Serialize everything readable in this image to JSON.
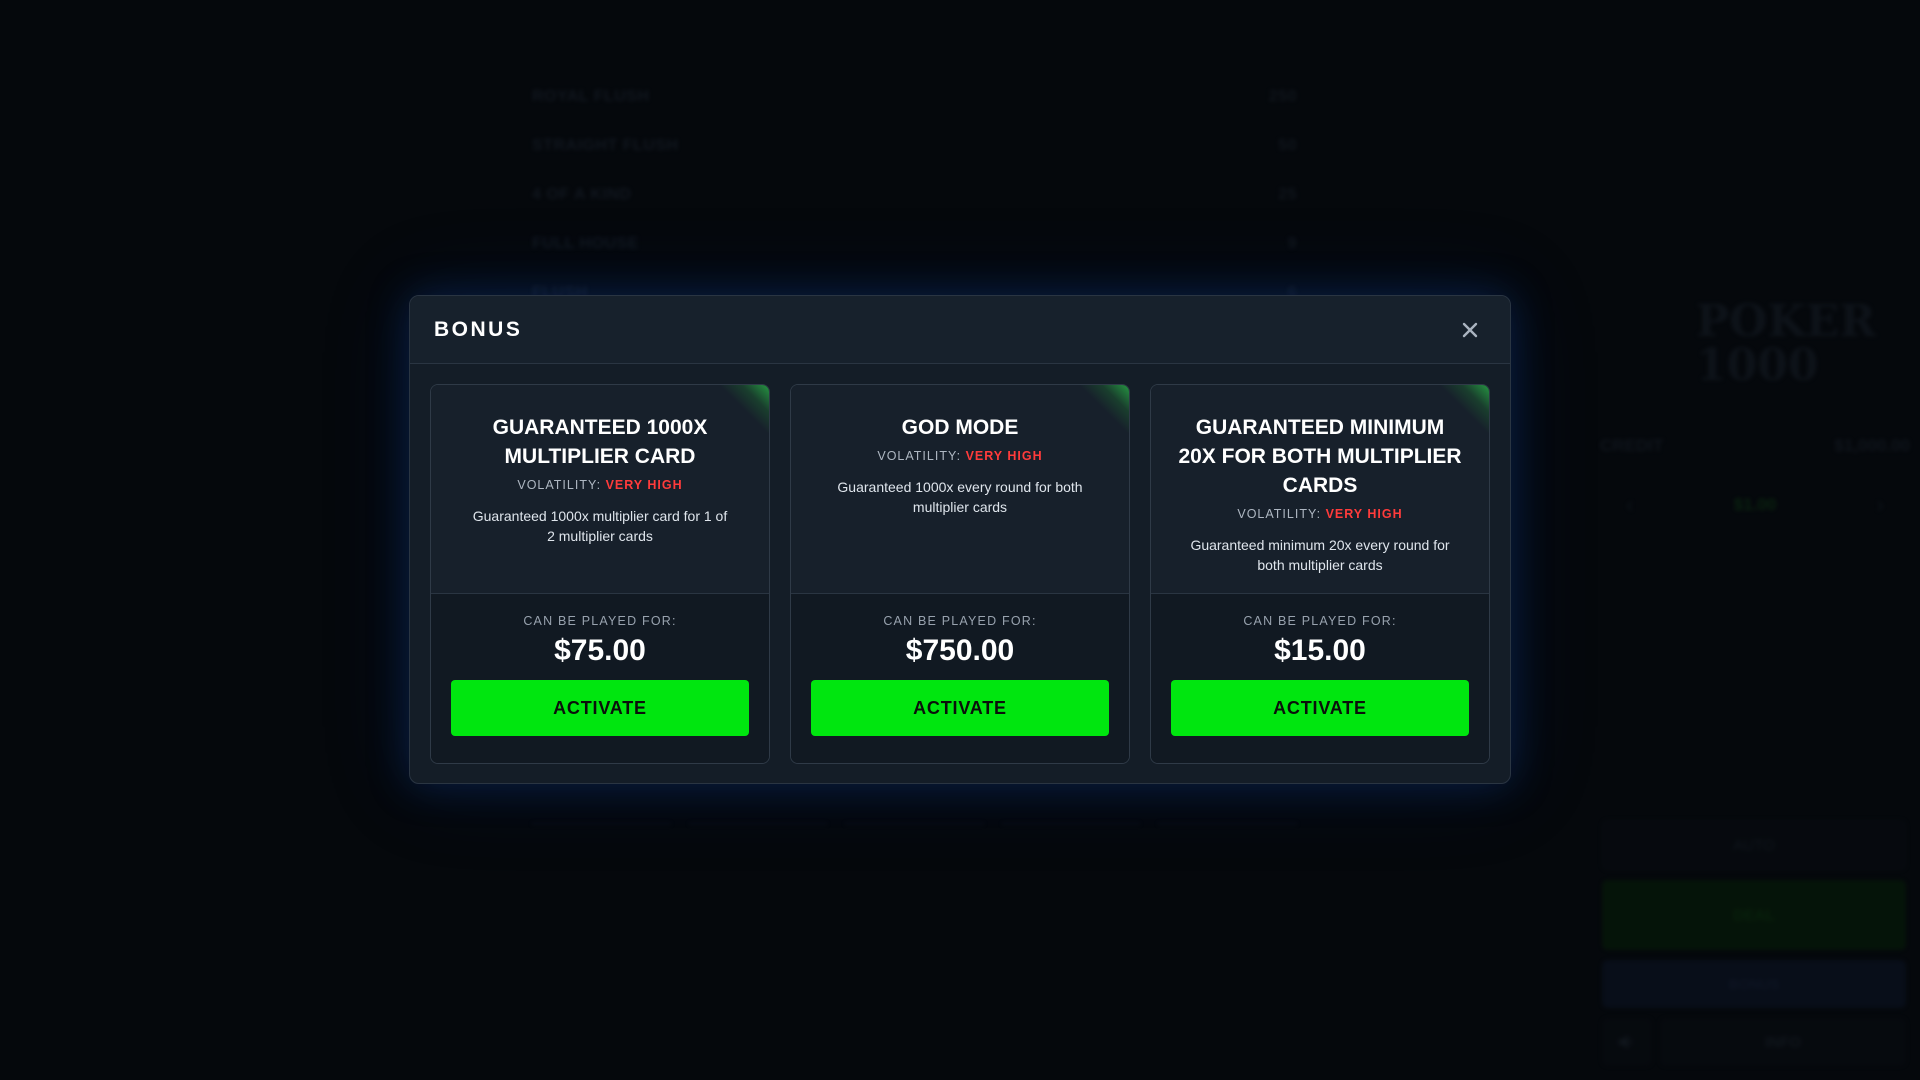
{
  "background": {
    "paytable": [
      {
        "hand": "ROYAL FLUSH",
        "mult": "250"
      },
      {
        "hand": "STRAIGHT FLUSH",
        "mult": "50"
      },
      {
        "hand": "4 OF A KIND",
        "mult": "25"
      },
      {
        "hand": "FULL HOUSE",
        "mult": "9"
      },
      {
        "hand": "FLUSH",
        "mult": "6"
      }
    ],
    "logo": "POKER 1000",
    "credit_label": "CREDIT",
    "credit_value": "$1,000.00",
    "bet_value": "$1.00",
    "bet_minus": "‹",
    "bet_plus": "›",
    "auto_label": "AUTO",
    "deal_label": "DEAL",
    "bonus_label": "BONUS",
    "info_label": "INFO",
    "sound_icon": "speaker-icon"
  },
  "modal": {
    "title": "BONUS",
    "close_icon": "close-icon",
    "accent_color": "#00e60f",
    "danger_color": "#ff3b3b",
    "cards": [
      {
        "title": "GUARANTEED 1000X MULTIPLIER CARD",
        "volatility_label": "VOLATILITY:",
        "volatility_value": "VERY HIGH",
        "description": "Guaranteed 1000x multiplier card for 1 of 2 multiplier cards",
        "played_label": "CAN BE PLAYED FOR:",
        "price": "$75.00",
        "button_label": "ACTIVATE"
      },
      {
        "title": "GOD MODE",
        "volatility_label": "VOLATILITY:",
        "volatility_value": "VERY HIGH",
        "description": "Guaranteed 1000x every round for both multiplier cards",
        "played_label": "CAN BE PLAYED FOR:",
        "price": "$750.00",
        "button_label": "ACTIVATE"
      },
      {
        "title": "GUARANTEED MINIMUM 20X FOR BOTH MULTIPLIER CARDS",
        "volatility_label": "VOLATILITY:",
        "volatility_value": "VERY HIGH",
        "description": "Guaranteed minimum 20x every round for both multiplier cards",
        "played_label": "CAN BE PLAYED FOR:",
        "price": "$15.00",
        "button_label": "ACTIVATE"
      }
    ]
  }
}
